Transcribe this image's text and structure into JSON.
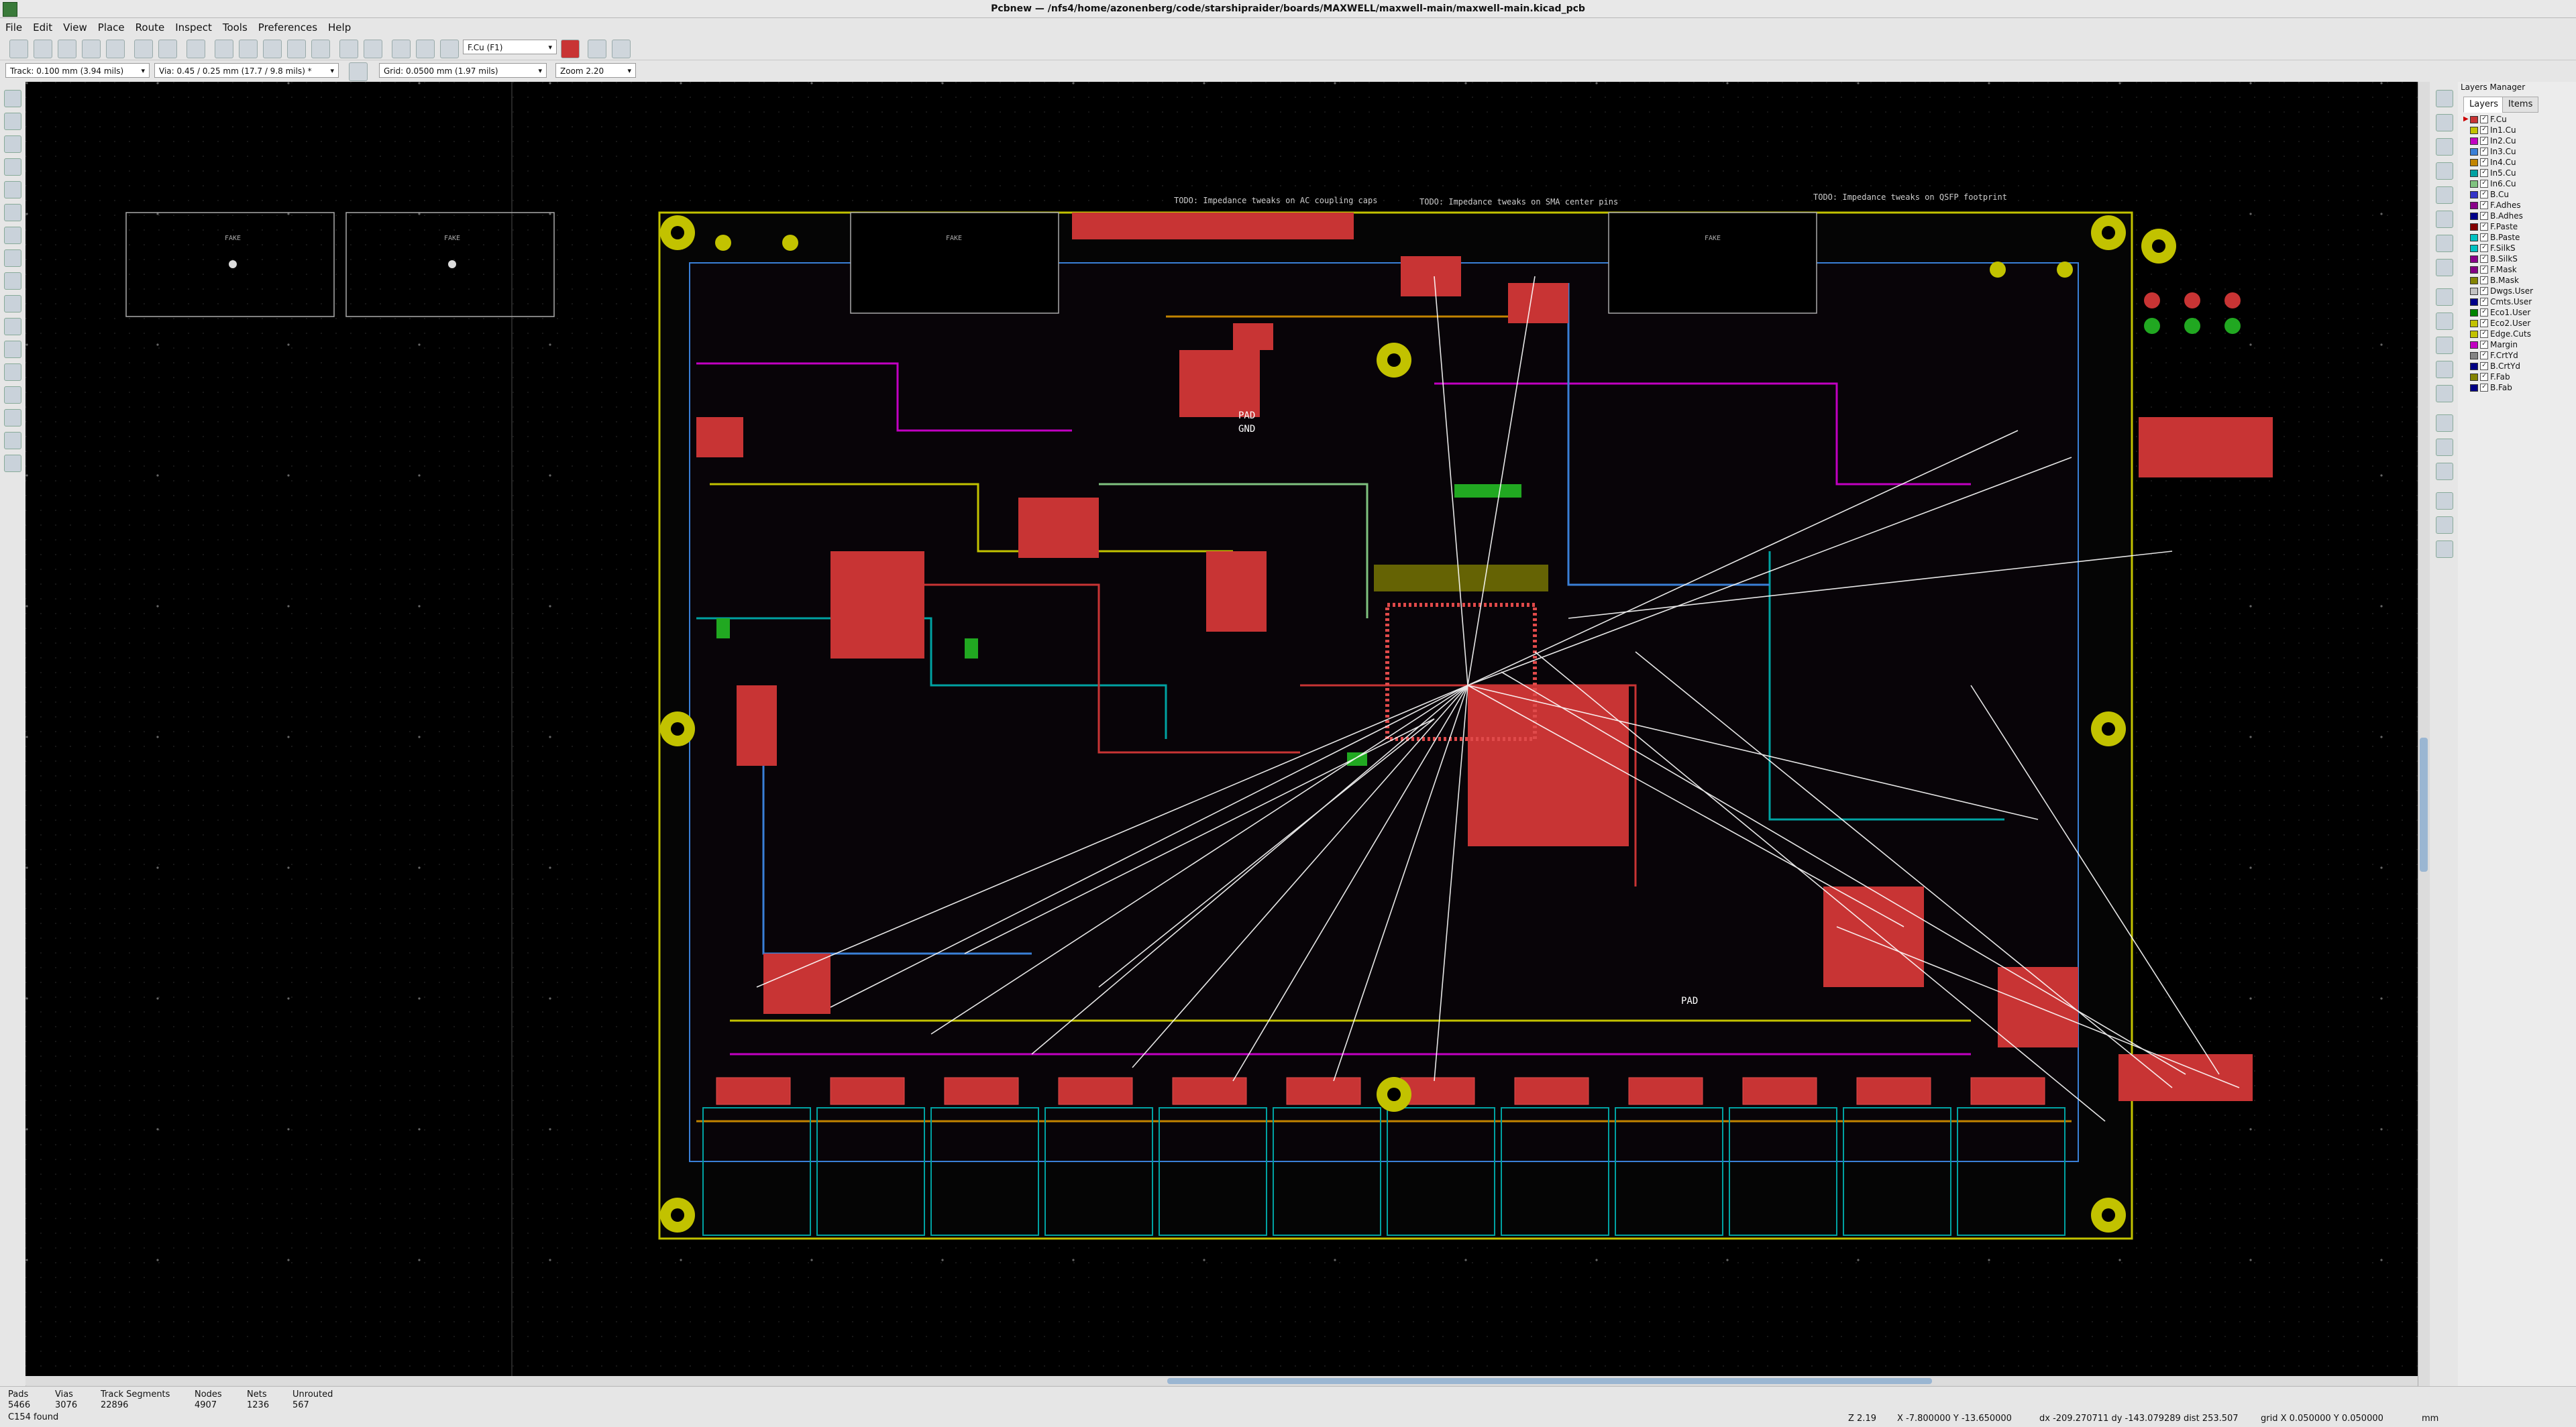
{
  "window": {
    "title": "Pcbnew — /nfs4/home/azonenberg/code/starshipraider/boards/MAXWELL/maxwell-main/maxwell-main.kicad_pcb"
  },
  "menu": [
    "File",
    "Edit",
    "View",
    "Place",
    "Route",
    "Inspect",
    "Tools",
    "Preferences",
    "Help"
  ],
  "toolbar": {
    "layer_select": "F.Cu (F1)",
    "track": "Track: 0.100 mm (3.94 mils)",
    "via": "Via: 0.45 / 0.25 mm (17.7 / 9.8 mils) *",
    "grid": "Grid: 0.0500 mm (1.97 mils)",
    "zoom": "Zoom 2.20"
  },
  "layers_manager": {
    "title": "Layers Manager",
    "tabs": [
      "Layers",
      "Items"
    ],
    "layers": [
      {
        "name": "F.Cu",
        "color": "#c83434",
        "active": true
      },
      {
        "name": "In1.Cu",
        "color": "#c2c200"
      },
      {
        "name": "In2.Cu",
        "color": "#c200c2"
      },
      {
        "name": "In3.Cu",
        "color": "#3a7fd6"
      },
      {
        "name": "In4.Cu",
        "color": "#c28400"
      },
      {
        "name": "In5.Cu",
        "color": "#00a2a2"
      },
      {
        "name": "In6.Cu",
        "color": "#7fc27f"
      },
      {
        "name": "B.Cu",
        "color": "#3434c8"
      },
      {
        "name": "F.Adhes",
        "color": "#8a008a"
      },
      {
        "name": "B.Adhes",
        "color": "#00008a"
      },
      {
        "name": "F.Paste",
        "color": "#840000"
      },
      {
        "name": "B.Paste",
        "color": "#00c2c2"
      },
      {
        "name": "F.SilkS",
        "color": "#00c2c2"
      },
      {
        "name": "B.SilkS",
        "color": "#8a008a"
      },
      {
        "name": "F.Mask",
        "color": "#840084"
      },
      {
        "name": "B.Mask",
        "color": "#848400"
      },
      {
        "name": "Dwgs.User",
        "color": "#c2c2c2"
      },
      {
        "name": "Cmts.User",
        "color": "#00008a"
      },
      {
        "name": "Eco1.User",
        "color": "#008400"
      },
      {
        "name": "Eco2.User",
        "color": "#c2c200"
      },
      {
        "name": "Edge.Cuts",
        "color": "#c2c200"
      },
      {
        "name": "Margin",
        "color": "#c200c2"
      },
      {
        "name": "F.CrtYd",
        "color": "#848484"
      },
      {
        "name": "B.CrtYd",
        "color": "#000084"
      },
      {
        "name": "F.Fab",
        "color": "#848400"
      },
      {
        "name": "B.Fab",
        "color": "#000084"
      }
    ]
  },
  "board_notes": [
    "TODO: Impedance tweaks on AC coupling caps",
    "TODO: Impedance tweaks on SMA center pins",
    "TODO: Impedance tweaks on QSFP footprint"
  ],
  "board_labels": {
    "fake1": "FAKE",
    "fake2": "FAKE",
    "fake3": "FAKE",
    "fake4": "FAKE",
    "pad1": "PAD",
    "pad2": "PAD",
    "gnd": "GND"
  },
  "status": {
    "pads_label": "Pads",
    "pads": "5466",
    "vias_label": "Vias",
    "vias": "3076",
    "tracks_label": "Track Segments",
    "tracks": "22896",
    "nodes_label": "Nodes",
    "nodes": "4907",
    "nets_label": "Nets",
    "nets": "1236",
    "unrouted_label": "Unrouted",
    "unrouted": "567",
    "message": "C154 found",
    "zoom": "Z 2.19",
    "coords": "X -7.800000  Y -13.650000",
    "delta": "dx -209.270711  dy -143.079289  dist 253.507",
    "grid": "grid X 0.050000  Y 0.050000",
    "units": "mm"
  }
}
